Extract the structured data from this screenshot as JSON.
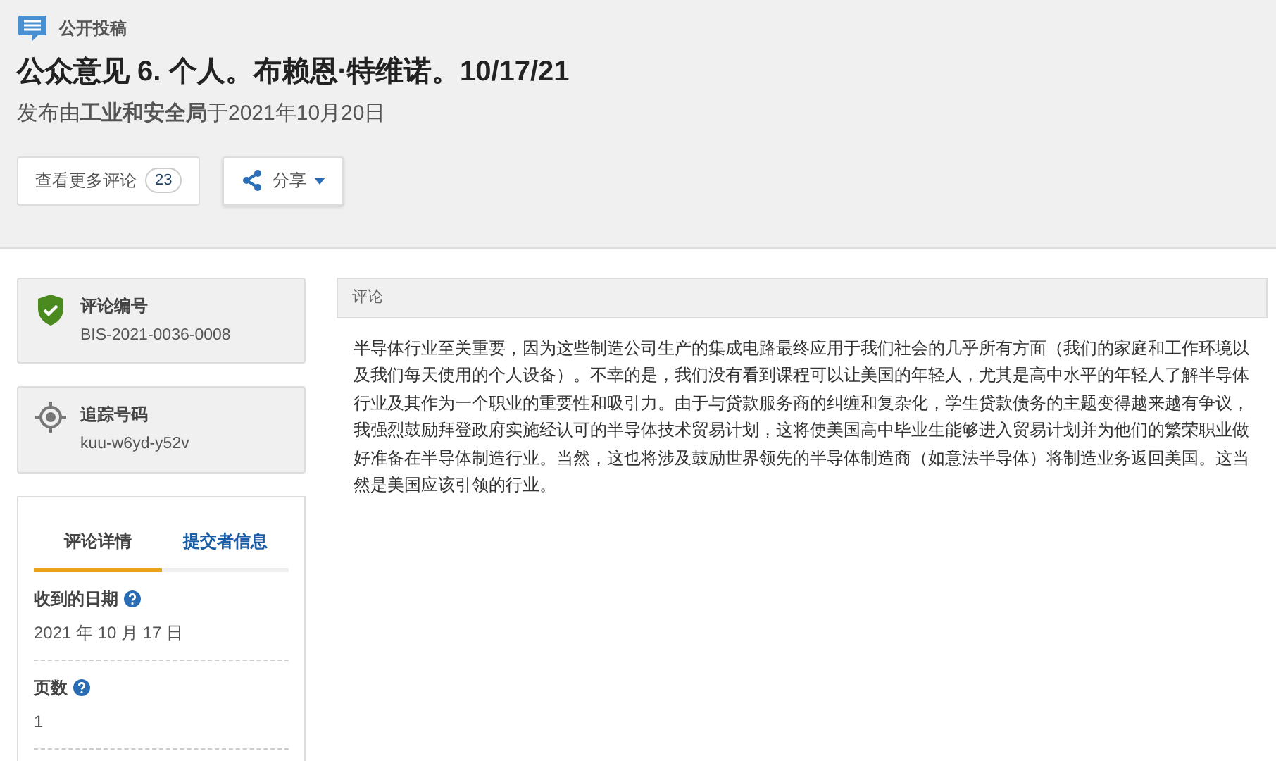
{
  "header": {
    "category": "公开投稿",
    "title": "公众意见 6. 个人。布赖恩·特维诺。10/17/21",
    "posted": "发布由**工业和安全局**于2021年10月20日",
    "more_comments": {
      "label": "查看更多评论",
      "count": "23"
    },
    "share": {
      "label": "分享"
    }
  },
  "id_cards": [
    {
      "kind": "verified",
      "label": "评论编号",
      "value": "BIS-2021-0036-0008"
    },
    {
      "kind": "tracking",
      "label": "追踪号码",
      "value": "kuu-w6yd-y52v"
    }
  ],
  "details": {
    "tabs": [
      {
        "label": "评论详情",
        "selected": true
      },
      {
        "label": "提交者信息",
        "selected": false
      }
    ],
    "fields": [
      {
        "label": "收到的日期",
        "value": "2021 年 10 月 17 日",
        "help": true
      },
      {
        "label": "页数",
        "value": "1",
        "help": true
      }
    ]
  },
  "comment": {
    "heading": "评论",
    "body": "半导体行业至关重要，因为这些制造公司生产的集成电路最终应用于我们社会的几乎所有方面（我们的家庭和工作环境以及我们每天使用的个人设备）。不幸的是，我们没有看到课程可以让美国的年轻人，尤其是高中水平的年轻人了解半导体行业及其作为一个职业的重要性和吸引力。由于与贷款服务商的纠缠和复杂化，学生贷款债务的主题变得越来越有争议，我强烈鼓励拜登政府实施经认可的半导体技术贸易计划，这将使美国高中毕业生能够进入贸易计划并为他们的繁荣职业做好准备在半导体制造行业。当然，这也将涉及鼓励世界领先的半导体制造商（如意法半导体）将制造业务返回美国。这当然是美国应该引领的行业。"
  }
}
